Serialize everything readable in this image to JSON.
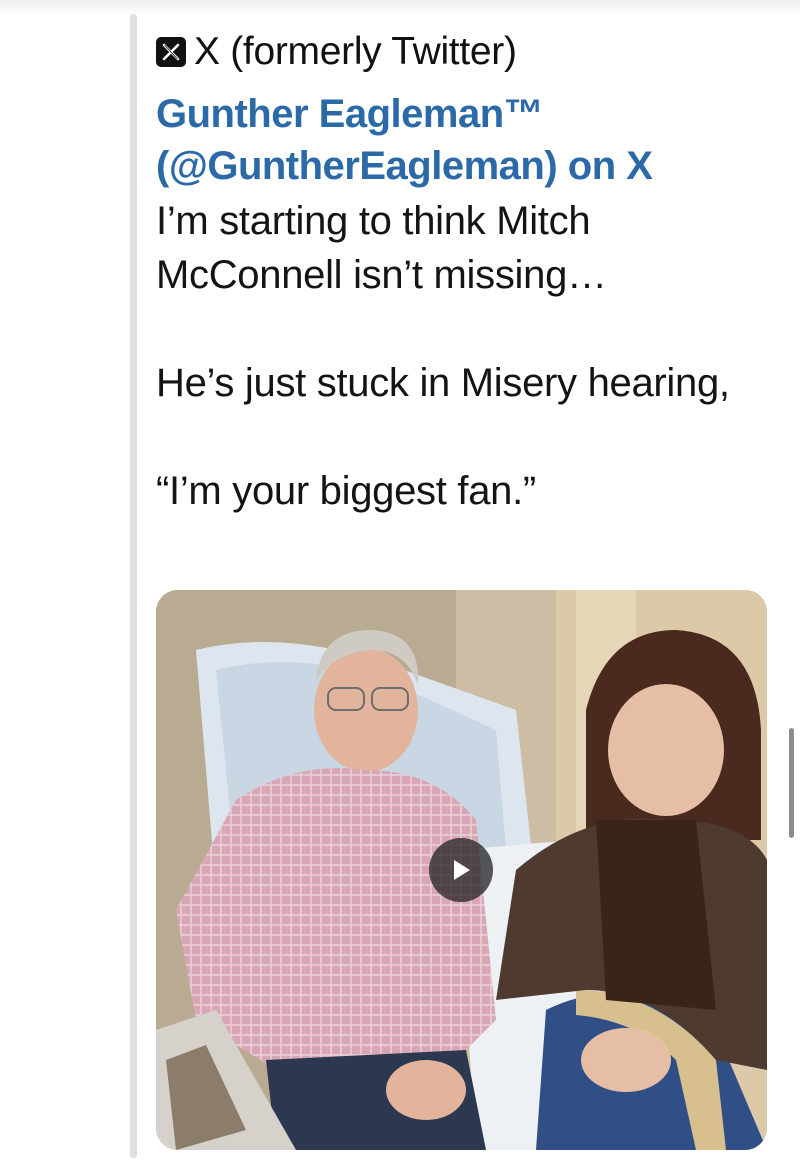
{
  "embed": {
    "source_icon": "x-logo-icon",
    "source_label": "X (formerly Twitter)",
    "author_title": "Gunther Eagleman™ (@GuntherEagleman) on X",
    "tweet_paragraphs": [
      "I’m starting to think Mitch McConnell isn’t missing…",
      "He’s just stuck in Misery hearing,",
      "“I’m your biggest fan.”"
    ]
  },
  "media": {
    "type": "video",
    "play_icon": "play-icon"
  },
  "colors": {
    "link": "#2b6aa6",
    "text": "#141414",
    "quote_bar": "#dedede"
  }
}
